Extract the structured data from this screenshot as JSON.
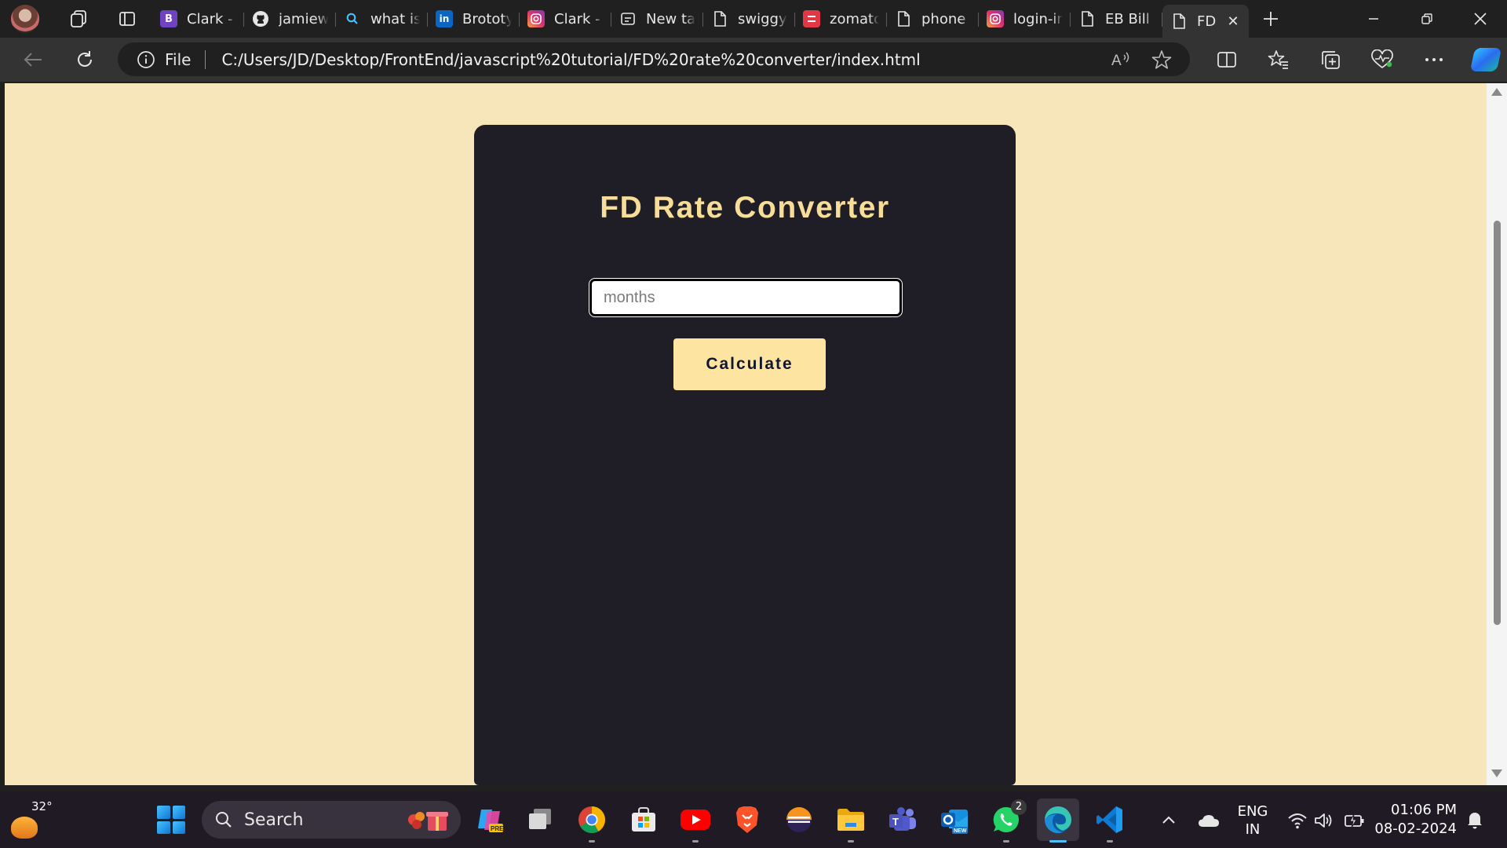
{
  "browser": {
    "tabs": [
      {
        "label": "Clark - P",
        "favicon": "bootstrap-icon"
      },
      {
        "label": "jamiewil",
        "favicon": "github-icon"
      },
      {
        "label": "what is",
        "favicon": "search-icon"
      },
      {
        "label": "Brototyp",
        "favicon": "linkedin-icon"
      },
      {
        "label": "Clark - P",
        "favicon": "instagram-icon"
      },
      {
        "label": "New tab",
        "favicon": "new-tab-page-icon"
      },
      {
        "label": "swiggy",
        "favicon": "document-icon"
      },
      {
        "label": "zomato",
        "favicon": "zomato-icon"
      },
      {
        "label": "phone",
        "favicon": "document-icon"
      },
      {
        "label": "login-in",
        "favicon": "instagram-icon"
      },
      {
        "label": "EB Bill C",
        "favicon": "document-icon"
      }
    ],
    "active_tab": {
      "label": "FD",
      "favicon": "document-icon"
    },
    "address": {
      "site_info_label": "File",
      "url": "C:/Users/JD/Desktop/FrontEnd/javascript%20tutorial/FD%20rate%20converter/index.html"
    }
  },
  "page": {
    "title": "FD Rate Converter",
    "months_input": {
      "value": "",
      "placeholder": "months"
    },
    "calculate_label": "Calculate",
    "colors": {
      "background": "#f6e6b9",
      "card": "#1f1e26",
      "title": "#f8dd98",
      "button": "#fde4a1",
      "button_text": "#0f1733"
    }
  },
  "taskbar": {
    "weather_temp": "32°",
    "search_label": "Search",
    "whatsapp_badge": "2",
    "language": {
      "line1": "ENG",
      "line2": "IN"
    },
    "clock": {
      "time": "01:06 PM",
      "date": "08-02-2024"
    }
  }
}
